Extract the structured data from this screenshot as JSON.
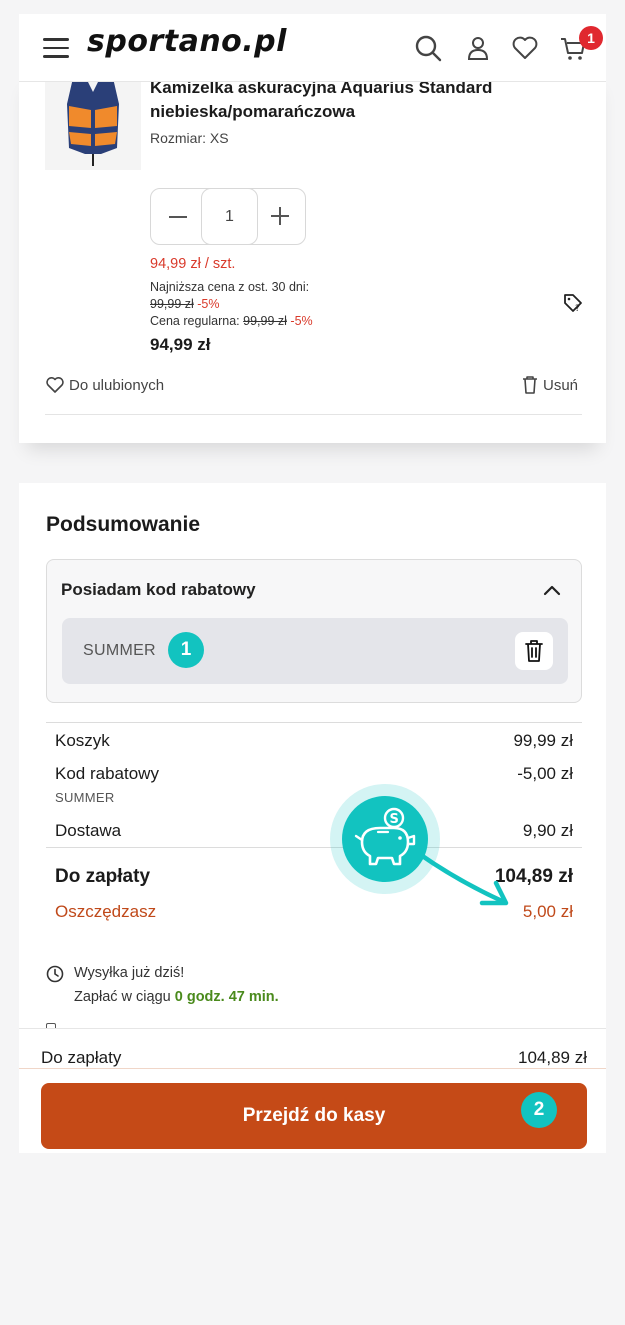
{
  "header": {
    "logo": "sportano.pl",
    "cart_count": "1"
  },
  "product": {
    "name": "Kamizelka askuracyjna Aquarius Standard niebieska/pomarańczowa",
    "size": "Rozmiar: XS",
    "quantity": "1",
    "unit_price": "94,99 zł / szt.",
    "lowest_label": "Najniższa cena z ost. 30 dni:",
    "lowest_price": "99,99 zł",
    "lowest_discount": "-5%",
    "regular_label": "Cena regularna:",
    "regular_price": "99,99 zł",
    "regular_discount": "-5%",
    "final_price": "94,99 zł",
    "favorite_label": "Do ulubionych",
    "remove_label": "Usuń"
  },
  "summary": {
    "title": "Podsumowanie",
    "coupon_header": "Posiadam kod rabatowy",
    "coupon_code": "SUMMER",
    "rows": {
      "cart_label": "Koszyk",
      "cart_value": "99,99 zł",
      "discount_label": "Kod rabatowy",
      "discount_value": "-5,00 zł",
      "discount_code": "SUMMER",
      "shipping_label": "Dostawa",
      "shipping_value": "9,90 zł",
      "total_label": "Do zapłaty",
      "total_value": "104,89 zł",
      "savings_label": "Oszczędzasz",
      "savings_value": "5,00 zł"
    },
    "shipping_note": "Wysyłka już dziś!",
    "pay_within_prefix": "Zapłać w ciągu",
    "pay_within_time": "0 godz. 47 min."
  },
  "annotations": {
    "badge_1": "1",
    "badge_2": "2"
  },
  "bottom_bar": {
    "total_label": "Do zapłaty",
    "total_value": "104,89 zł",
    "checkout_label": "Przejdź do kasy"
  },
  "colors": {
    "accent": "#c54a17",
    "teal": "#12c3c0",
    "price_red": "#d93a2b",
    "timer_green": "#4a8a1c"
  }
}
